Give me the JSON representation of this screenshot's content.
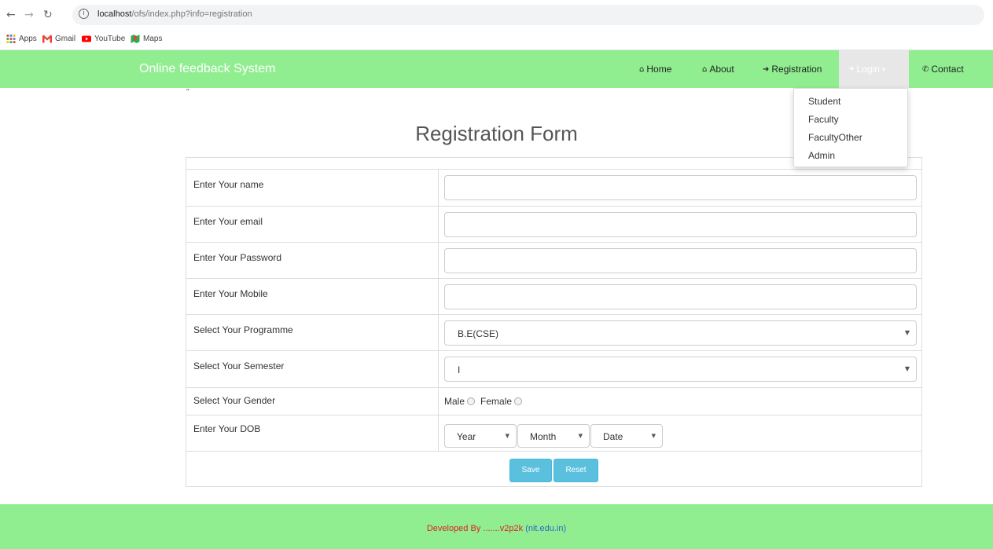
{
  "browser": {
    "url_host": "localhost",
    "url_path": "/ofs/index.php?info=registration",
    "bookmarks": [
      {
        "label": "Apps",
        "icon": "apps-grid-icon"
      },
      {
        "label": "Gmail",
        "icon": "gmail-icon"
      },
      {
        "label": "YouTube",
        "icon": "youtube-icon"
      },
      {
        "label": "Maps",
        "icon": "maps-icon"
      }
    ]
  },
  "navbar": {
    "brand": "Online feedback System",
    "items": [
      {
        "label": "Home",
        "icon": "home-icon"
      },
      {
        "label": "About",
        "icon": "home-icon"
      },
      {
        "label": "Registration",
        "icon": "sign-out-icon"
      },
      {
        "label": "Login",
        "icon": "sign-in-icon"
      },
      {
        "label": "Contact",
        "icon": "phone-icon"
      }
    ],
    "login_dropdown": [
      "Student",
      "Faculty",
      "FacultyOther",
      "Admin"
    ]
  },
  "stray_mark": "\"",
  "form": {
    "title": "Registration Form",
    "rows": {
      "name": "Enter Your name",
      "email": "Enter Your email",
      "password": "Enter Your Password",
      "mobile": "Enter Your Mobile",
      "programme": "Select Your Programme",
      "semester": "Select Your Semester",
      "gender": "Select Your Gender",
      "dob": "Enter Your DOB"
    },
    "programme_value": "B.E(CSE)",
    "semester_value": "I",
    "gender_options": [
      "Male",
      "Female"
    ],
    "dob": {
      "year": "Year",
      "month": "Month",
      "date": "Date"
    },
    "buttons": {
      "save": "Save",
      "reset": "Reset"
    }
  },
  "footer": {
    "developed": "Developed By .......v2p2k",
    "link": "(nit.edu.in)"
  },
  "colors": {
    "navbar_bg": "#90ee90",
    "button_bg": "#5bc0de",
    "footer_dev": "#e02020",
    "footer_link": "#3366cc"
  }
}
